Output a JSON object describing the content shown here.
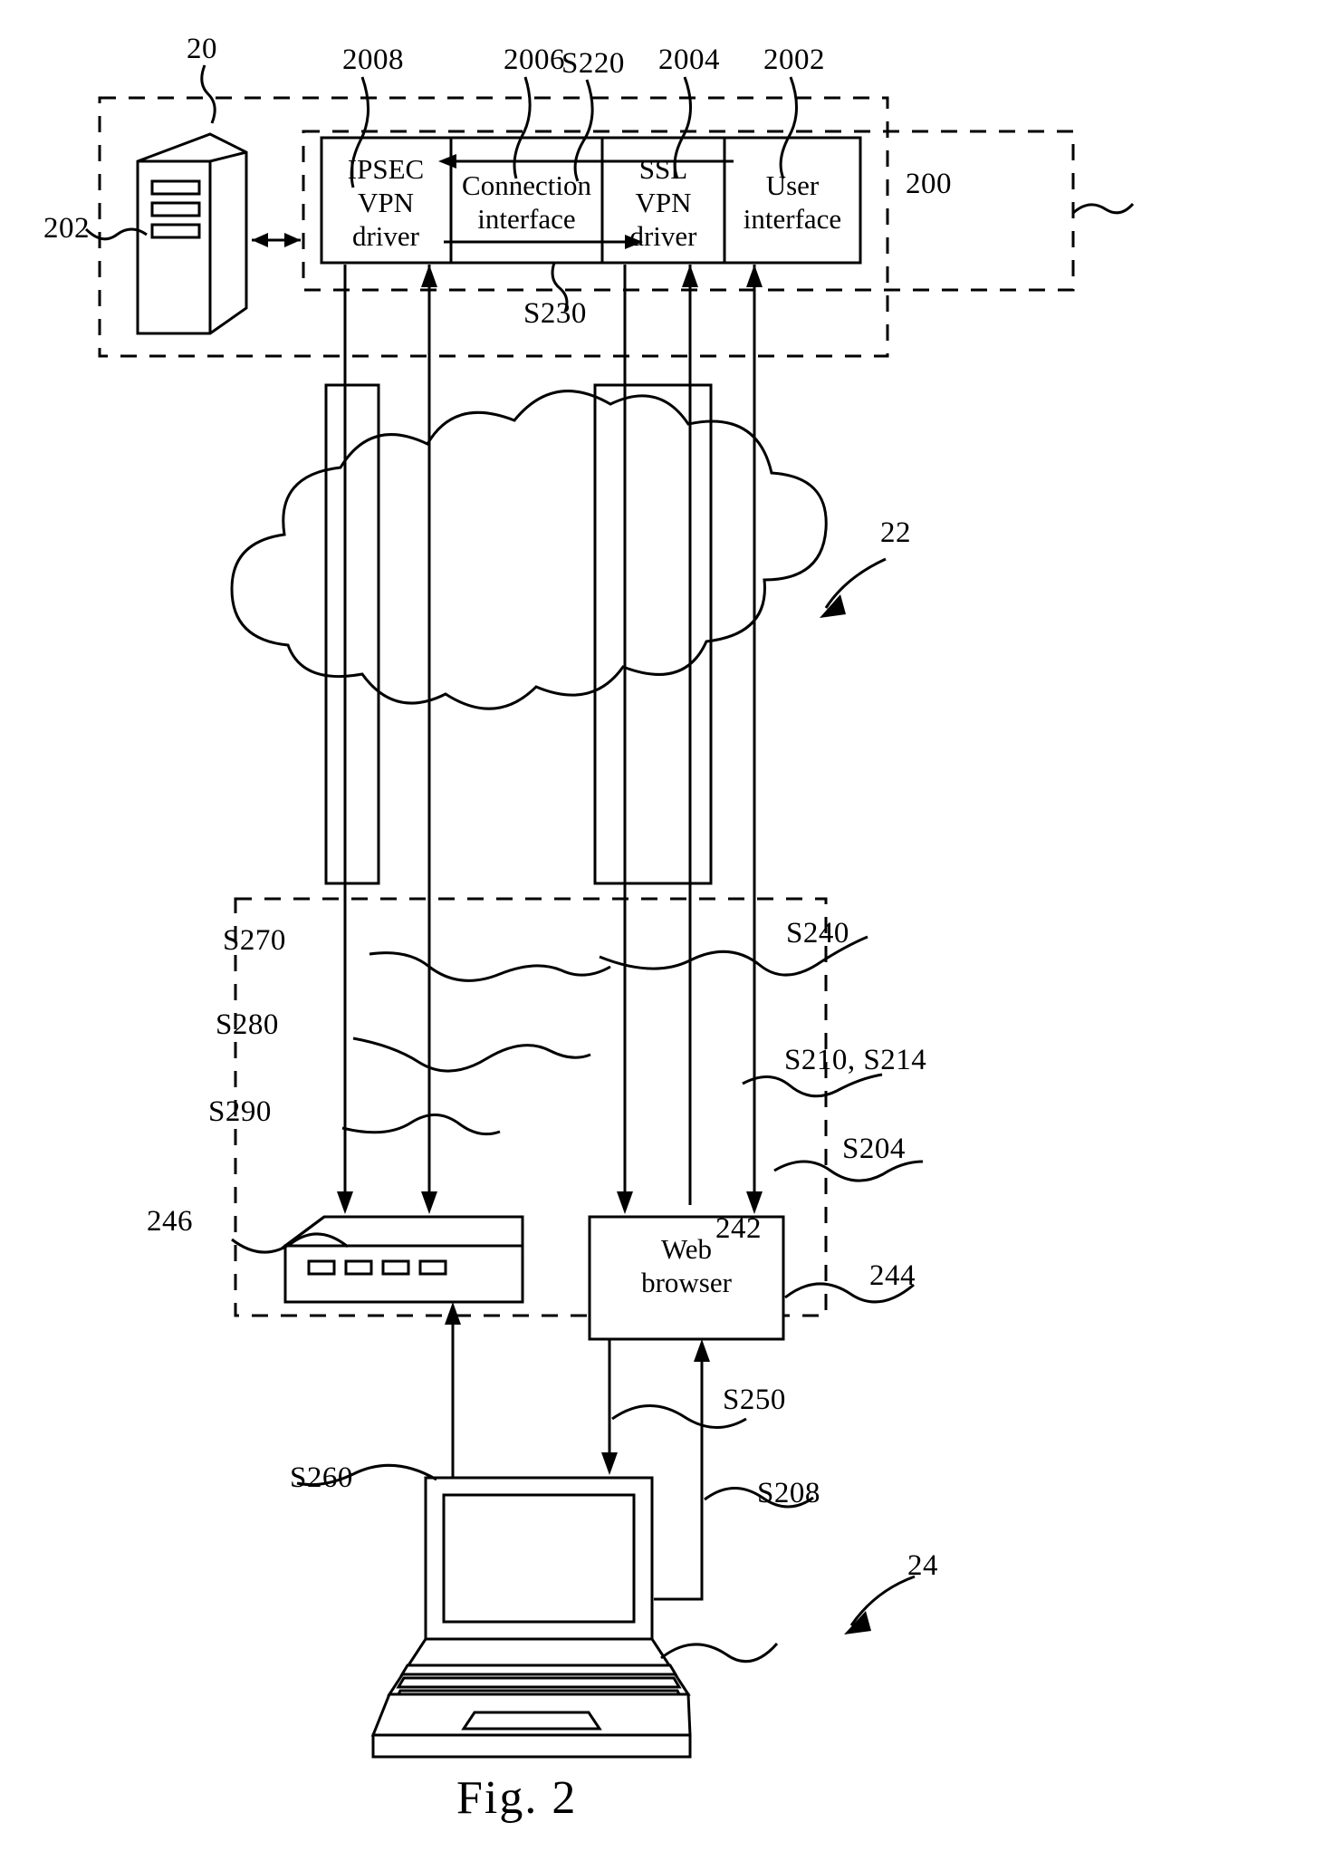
{
  "figure": {
    "caption": "Fig. 2"
  },
  "blocks": {
    "ipsec_vpn_driver": "IPSEC\nVPN\ndriver",
    "ipsec_vpn_driver_lines": [
      "IPSEC",
      "VPN",
      "driver"
    ],
    "connection_interface_lines": [
      "Connection",
      "interface"
    ],
    "ssl_vpn_driver_lines": [
      "SSL",
      "VPN",
      "driver"
    ],
    "user_interface_lines": [
      "User",
      "interface"
    ],
    "web_browser_lines": [
      "Web",
      "browser"
    ]
  },
  "reference_numerals": {
    "group_20": "20",
    "server_202": "202",
    "ipsec_driver_2008": "2008",
    "connection_interface_2006": "2006",
    "ssl_driver_2004": "2004",
    "user_interface_2002": "2002",
    "gateway_200": "200",
    "cloud_22": "22",
    "router_246": "246",
    "web_browser_244": "244",
    "laptop_242": "242",
    "client_site_24": "24"
  },
  "step_labels": {
    "s220": "S220",
    "s230": "S230",
    "s240": "S240",
    "s210_s214": "S210, S214",
    "s204": "S204",
    "s250": "S250",
    "s208": "S208",
    "s260": "S260",
    "s270": "S270",
    "s280": "S280",
    "s290": "S290"
  },
  "icons": {
    "server": "server-tower-icon",
    "cloud": "network-cloud-icon",
    "router": "router-icon",
    "laptop": "laptop-icon"
  },
  "colors": {
    "stroke": "#000000",
    "background": "#ffffff"
  }
}
